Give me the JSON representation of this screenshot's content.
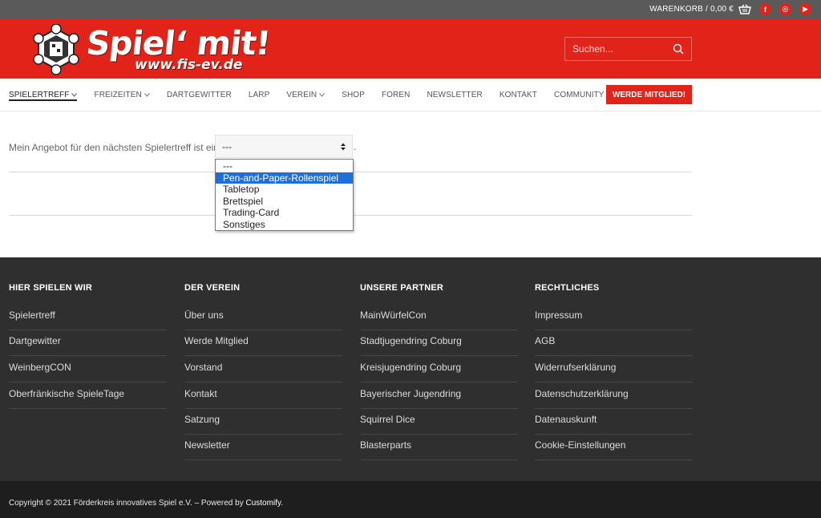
{
  "topbar": {
    "cart_text": "WARENKORB / 0,00 €",
    "cart_icon": "shopping-basket-icon",
    "social": [
      {
        "icon": "facebook-icon",
        "glyph": "f"
      },
      {
        "icon": "instagram-icon",
        "glyph": "◎"
      },
      {
        "icon": "youtube-icon",
        "glyph": "▶"
      }
    ]
  },
  "header": {
    "logo_title": "Spiel‘ mit!",
    "logo_url": "www.fis-ev.de",
    "search_placeholder": "Suchen...",
    "brand_color": "#e2231a"
  },
  "nav": {
    "items": [
      {
        "label": "SPIELERTREFF",
        "has_dropdown": true,
        "active": true
      },
      {
        "label": "FREIZEITEN",
        "has_dropdown": true,
        "active": false
      },
      {
        "label": "DARTGEWITTER",
        "has_dropdown": false,
        "active": false
      },
      {
        "label": "LARP",
        "has_dropdown": false,
        "active": false
      },
      {
        "label": "VEREIN",
        "has_dropdown": true,
        "active": false
      },
      {
        "label": "SHOP",
        "has_dropdown": false,
        "active": false
      },
      {
        "label": "FOREN",
        "has_dropdown": false,
        "active": false
      },
      {
        "label": "NEWSLETTER",
        "has_dropdown": false,
        "active": false
      },
      {
        "label": "KONTAKT",
        "has_dropdown": false,
        "active": false
      },
      {
        "label": "COMMUNITY",
        "has_dropdown": false,
        "active": false
      }
    ],
    "join_button": "WERDE MITGLIED!"
  },
  "form": {
    "label": "Mein Angebot für den nächsten Spielertreff ist ein",
    "selected_value": "---",
    "trailing": ".",
    "options": [
      "---",
      "Pen-and-Paper-Rollenspiel",
      "Tabletop",
      "Brettspiel",
      "Trading-Card",
      "Sonstiges"
    ],
    "highlighted_option": "Pen-and-Paper-Rollenspiel"
  },
  "footer": {
    "columns": [
      {
        "heading": "HIER SPIELEN WIR",
        "links": [
          "Spielertreff",
          "Dartgewitter",
          "WeinbergCON",
          "Oberfränkische SpieleTage"
        ]
      },
      {
        "heading": "DER VEREIN",
        "links": [
          "Über uns",
          "Werde Mitglied",
          "Vorstand",
          "Kontakt",
          "Satzung",
          "Newsletter"
        ]
      },
      {
        "heading": "UNSERE PARTNER",
        "links": [
          "MainWürfelCon",
          "Stadtjugendring Coburg",
          "Kreisjugendring Coburg",
          "Bayerischer Jugendring",
          "Squirrel Dice",
          "Blasterparts"
        ]
      },
      {
        "heading": "RECHTLICHES",
        "links": [
          "Impressum",
          "AGB",
          "Widerrufserklärung",
          "Datenschutzerklärung",
          "Datenauskunft",
          "Cookie-Einstellungen"
        ]
      }
    ],
    "copyright": "Copyright © 2021 Förderkreis innovatives Spiel e.V. – Powered by ",
    "powered_by": "Customify",
    "copyright_end": "."
  }
}
